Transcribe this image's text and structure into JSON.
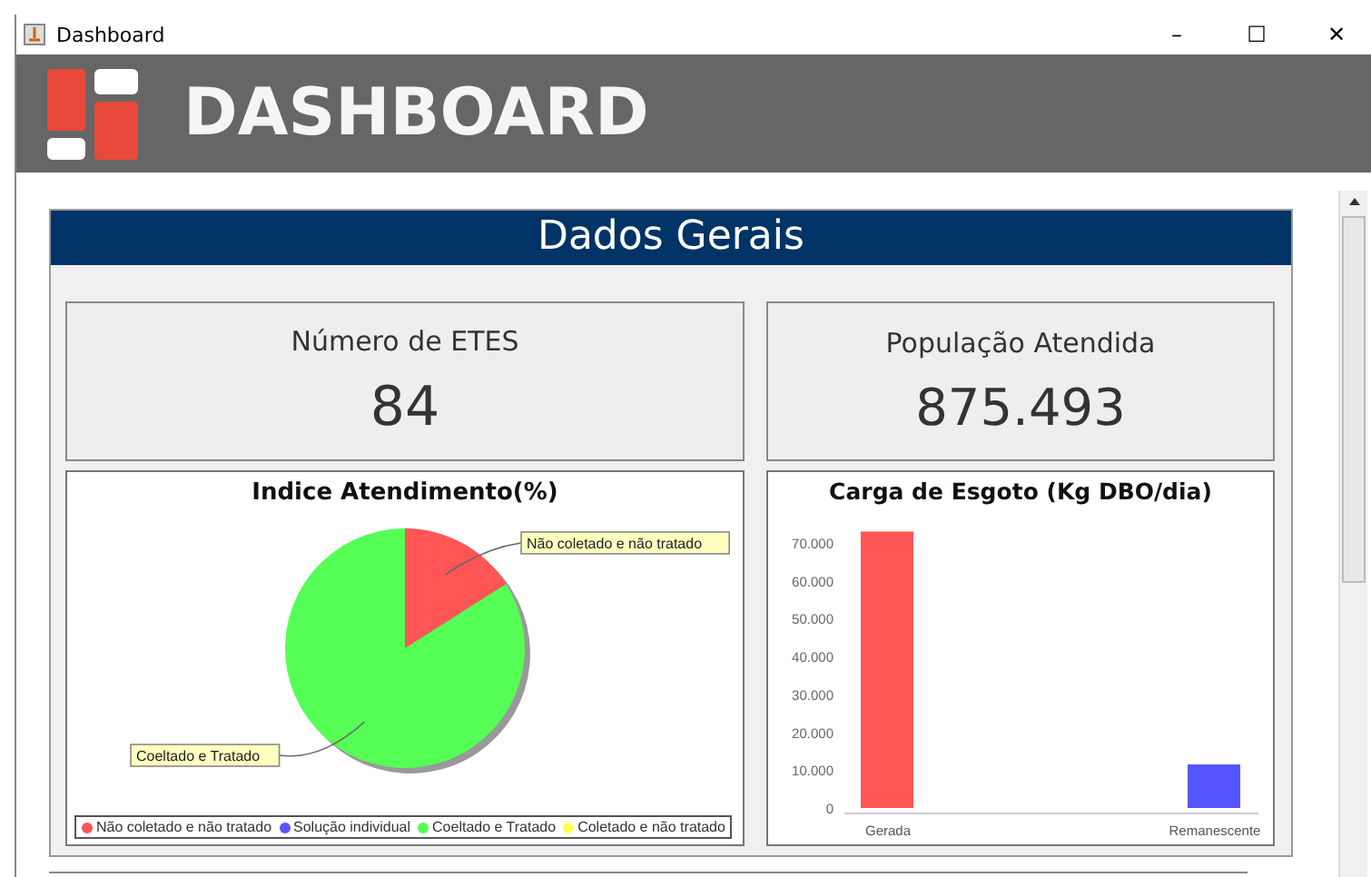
{
  "window": {
    "title": "Dashboard",
    "controls": [
      "–",
      "☐",
      "✕"
    ]
  },
  "header": {
    "title": "DASHBOARD"
  },
  "panel": {
    "title": "Dados Gerais",
    "stats": [
      {
        "label": "Número de ETES",
        "value": "84"
      },
      {
        "label": "População Atendida",
        "value": "875.493"
      }
    ],
    "pie": {
      "chart_data": {
        "type": "pie",
        "title": "Indice Atendimento(%)",
        "legend": "bottom",
        "categories": [
          "Não coletado e não tratado",
          "Solução individual",
          "Coeltado e Tratado",
          "Coletado e não tratado"
        ],
        "series": [
          {
            "values": [
              16,
              0,
              84,
              0
            ]
          }
        ]
      },
      "slices": [
        {
          "color": "#ff5555"
        },
        {
          "color": "#5555ff"
        },
        {
          "color": "#55ff55"
        },
        {
          "color": "#ffff55"
        }
      ],
      "labels": [
        "Não coletado e não tratado",
        "Coeltado e Tratado"
      ]
    },
    "bar": {
      "chart_data": {
        "type": "bar",
        "title": "Carga de Esgoto (Kg DBO/dia)",
        "categories": [
          "Gerada",
          "Remanescente"
        ],
        "series": [
          {
            "color": "#ff5555",
            "values": [
              73000,
              null
            ]
          },
          {
            "color": "#5555ff",
            "values": [
              null,
              11500
            ]
          }
        ],
        "ylim": [
          0,
          75000
        ],
        "yticks": [
          {
            "value": 0,
            "label": "0"
          },
          {
            "value": 10000,
            "label": "10.000"
          },
          {
            "value": 20000,
            "label": "20.000"
          },
          {
            "value": 30000,
            "label": "30.000"
          },
          {
            "value": 40000,
            "label": "40.000"
          },
          {
            "value": 50000,
            "label": "50.000"
          },
          {
            "value": 60000,
            "label": "60.000"
          },
          {
            "value": 70000,
            "label": "70.000"
          }
        ]
      }
    }
  }
}
